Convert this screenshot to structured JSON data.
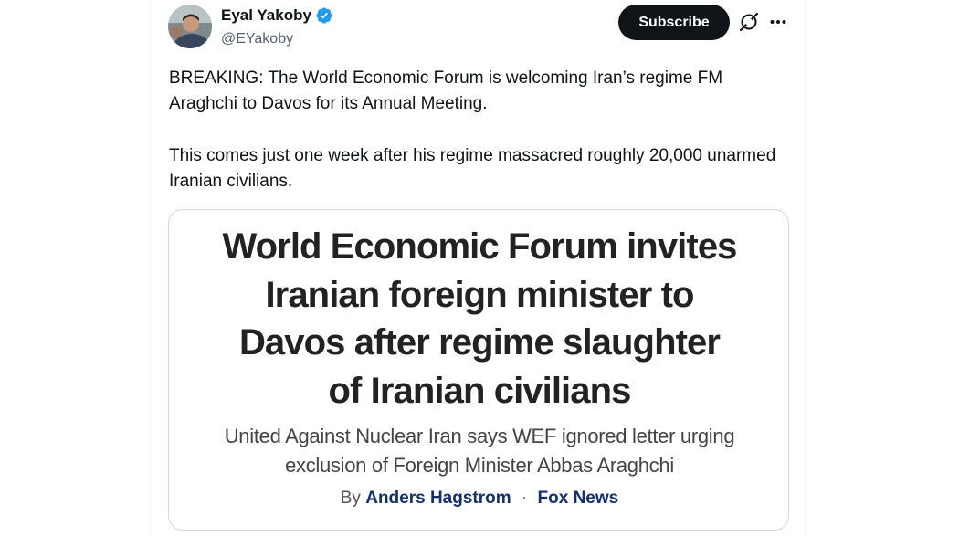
{
  "author": {
    "name": "Eyal Yakoby",
    "handle": "@EYakoby",
    "verified": true
  },
  "actions": {
    "subscribe_label": "Subscribe",
    "grok_icon": "grok-icon",
    "more_icon": "more-icon"
  },
  "tweet": {
    "paragraphs": [
      "BREAKING: The World Economic Forum is welcoming Iran’s regime FM Araghchi to Davos for its Annual Meeting.",
      "This comes just one week after his regime massacred roughly 20,000 unarmed Iranian civilians."
    ]
  },
  "card": {
    "headline_lines": [
      "World Economic Forum invites",
      "Iranian foreign minister to",
      "Davos after regime slaughter",
      "of Iranian civilians"
    ],
    "subhead_lines": [
      "United Against Nuclear Iran says WEF ignored letter urging",
      "exclusion of Foreign Minister Abbas Araghchi"
    ],
    "byline_prefix": "By",
    "byline_author": "Anders Hagstrom",
    "byline_separator": "·",
    "byline_outlet": "Fox News"
  },
  "colors": {
    "text_primary": "#0f1419",
    "text_secondary": "#536471",
    "verified_blue": "#1d9bf0",
    "byline_link": "#13306b"
  }
}
